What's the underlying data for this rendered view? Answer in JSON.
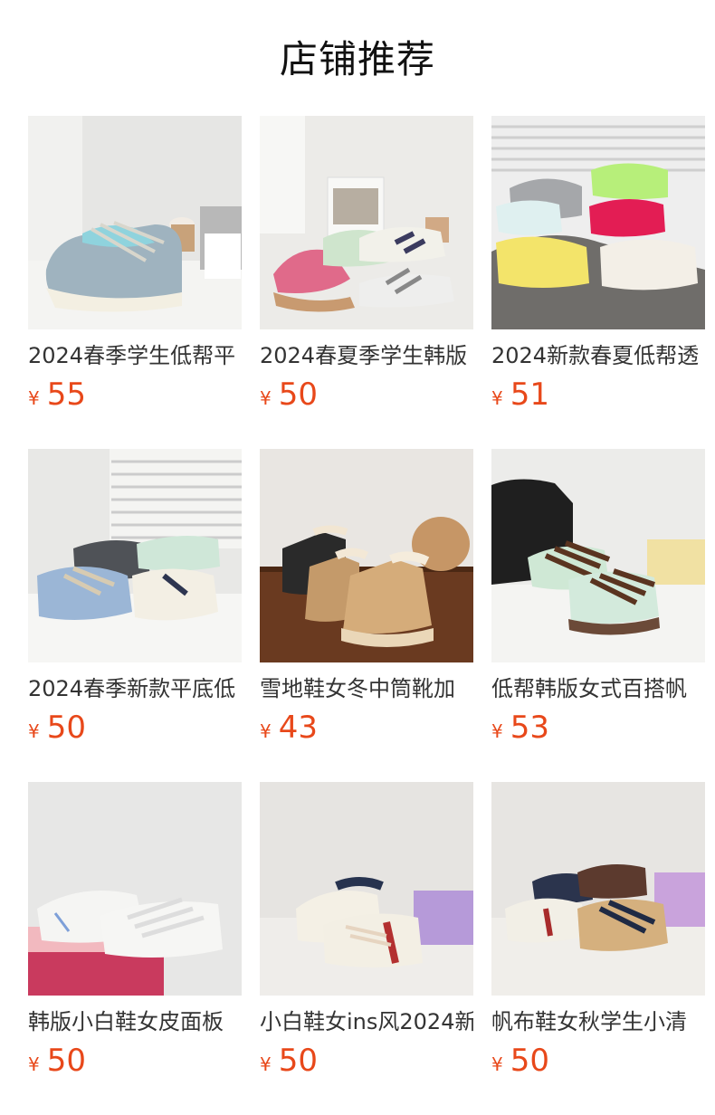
{
  "header": {
    "title": "店铺推荐"
  },
  "currency_symbol": "¥",
  "products": [
    {
      "title": "2024春季学生低帮平",
      "price": "55",
      "image": "blue-grey-sneaker-photo"
    },
    {
      "title": "2024春夏季学生韩版",
      "price": "50",
      "image": "assorted-sneakers-photo"
    },
    {
      "title": "2024新款春夏低帮透",
      "price": "51",
      "image": "colorful-sneakers-photo"
    },
    {
      "title": "2024春季新款平底低",
      "price": "50",
      "image": "pastel-sneakers-photo"
    },
    {
      "title": "雪地鞋女冬中筒靴加",
      "price": "43",
      "image": "snow-boots-photo"
    },
    {
      "title": "低帮韩版女式百搭帆",
      "price": "53",
      "image": "mint-brown-sneaker-photo"
    },
    {
      "title": "韩版小白鞋女皮面板",
      "price": "50",
      "image": "white-sneakers-photo"
    },
    {
      "title": "小白鞋女ins风2024新",
      "price": "50",
      "image": "cream-navy-sneakers-photo"
    },
    {
      "title": "帆布鞋女秋学生小清",
      "price": "50",
      "image": "canvas-sneakers-photo"
    }
  ]
}
